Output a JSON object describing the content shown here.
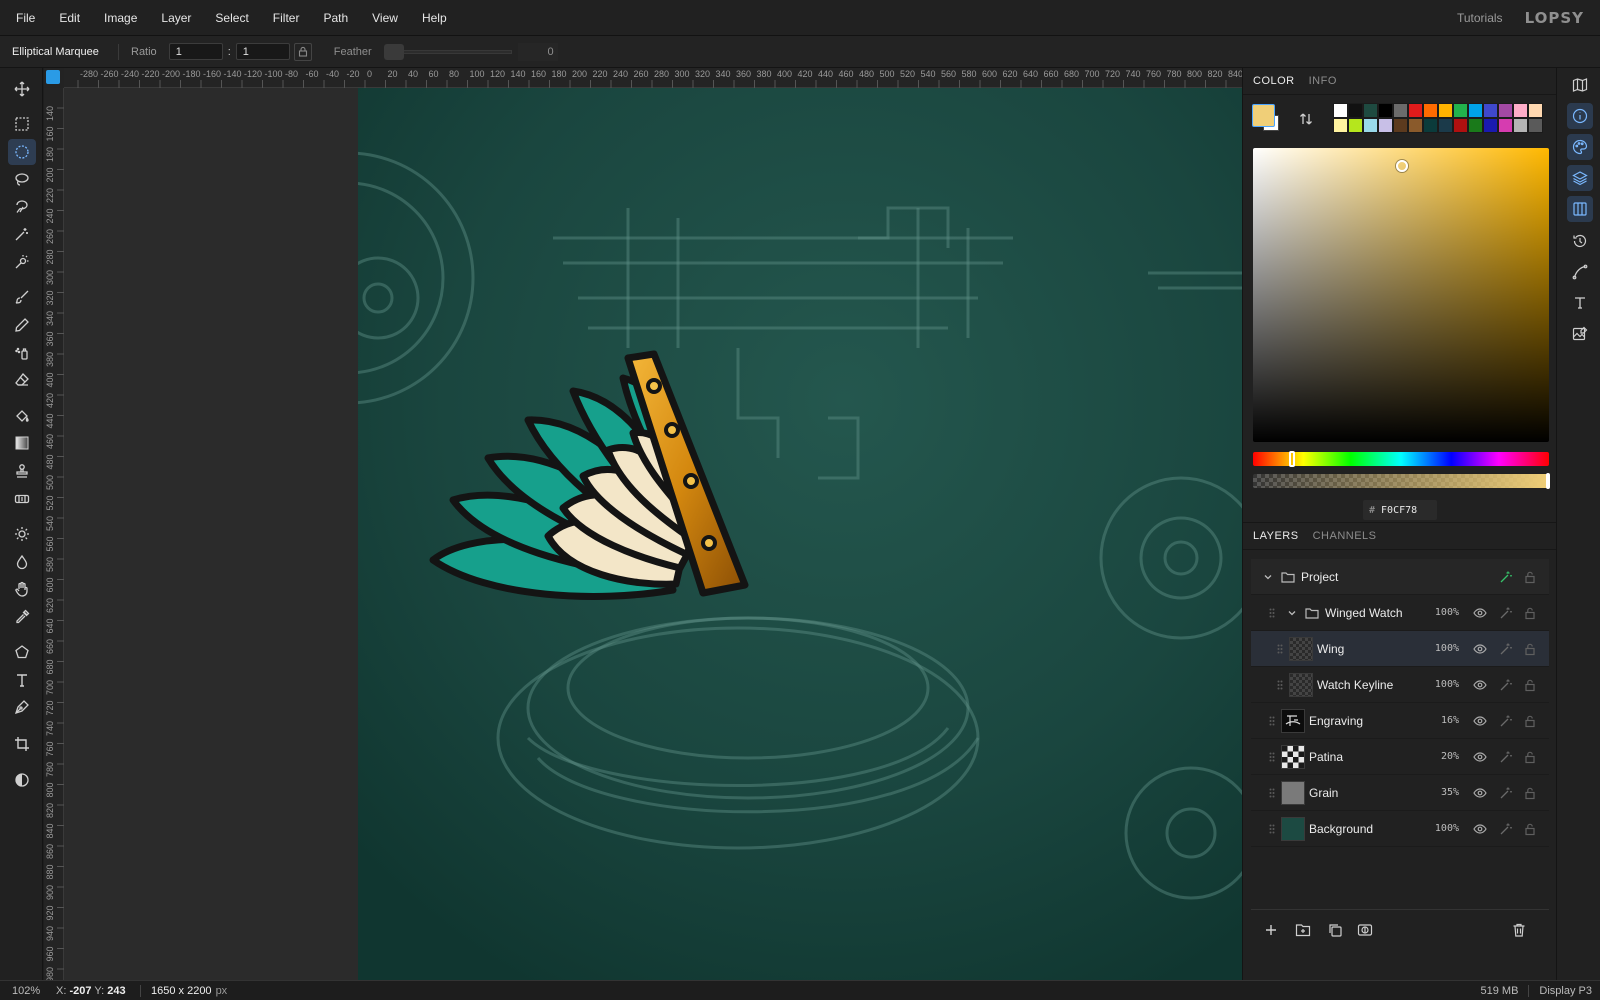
{
  "menu": [
    "File",
    "Edit",
    "Image",
    "Layer",
    "Select",
    "Filter",
    "Path",
    "View",
    "Help"
  ],
  "header": {
    "tutorials": "Tutorials",
    "brand": "LOPSY"
  },
  "options": {
    "tool_name": "Elliptical Marquee",
    "ratio_label": "Ratio",
    "ratio_w": "1",
    "ratio_colon": ":",
    "ratio_h": "1",
    "feather_label": "Feather",
    "feather_value": "0"
  },
  "tools": [
    {
      "name": "move-tool",
      "icon": "move-icon"
    },
    {
      "name": "rect-marquee-tool",
      "icon": "rect-marquee-icon"
    },
    {
      "name": "elliptical-marquee-tool",
      "icon": "ellipse-marquee-icon",
      "active": true
    },
    {
      "name": "lasso-tool",
      "icon": "lasso-icon"
    },
    {
      "name": "magnetic-lasso-tool",
      "icon": "magnetic-lasso-icon"
    },
    {
      "name": "magic-wand-tool",
      "icon": "magic-wand-icon"
    },
    {
      "name": "quick-selection-tool",
      "icon": "quick-selection-icon"
    },
    {
      "name": "brush-tool",
      "icon": "brush-icon"
    },
    {
      "name": "pencil-tool",
      "icon": "pencil-icon"
    },
    {
      "name": "spray-tool",
      "icon": "spray-icon"
    },
    {
      "name": "eraser-tool",
      "icon": "eraser-icon"
    },
    {
      "name": "paint-bucket-tool",
      "icon": "paint-bucket-icon"
    },
    {
      "name": "gradient-tool",
      "icon": "gradient-icon"
    },
    {
      "name": "clone-stamp-tool",
      "icon": "stamp-icon"
    },
    {
      "name": "healing-tool",
      "icon": "bandage-icon"
    },
    {
      "name": "dodge-tool",
      "icon": "sun-icon"
    },
    {
      "name": "blur-tool",
      "icon": "drop-icon"
    },
    {
      "name": "hand-tool",
      "icon": "hand-icon"
    },
    {
      "name": "eyedropper-tool",
      "icon": "eyedropper-icon"
    },
    {
      "name": "shape-tool",
      "icon": "pentagon-icon"
    },
    {
      "name": "text-tool",
      "icon": "text-icon"
    },
    {
      "name": "pen-tool",
      "icon": "pen-icon"
    },
    {
      "name": "crop-tool",
      "icon": "crop-icon"
    },
    {
      "name": "adjustment-tool",
      "icon": "contrast-icon"
    }
  ],
  "ruler_top_labels": [
    "-280",
    "-260",
    "-240",
    "-220",
    "-200",
    "-180",
    "-160",
    "-140",
    "-120",
    "-100",
    "-80",
    "-60",
    "-40",
    "-20",
    "0",
    "20",
    "40",
    "60",
    "80",
    "100",
    "120",
    "140",
    "160",
    "180",
    "200",
    "220",
    "240",
    "260",
    "280",
    "300",
    "320",
    "340",
    "360",
    "380",
    "400",
    "420",
    "440",
    "460",
    "480",
    "500",
    "520",
    "540",
    "560",
    "580",
    "600",
    "620",
    "640",
    "660",
    "680",
    "700",
    "720",
    "740",
    "760",
    "780",
    "800",
    "820",
    "840"
  ],
  "ruler_left_labels": [
    "140",
    "160",
    "180",
    "200",
    "220",
    "240",
    "260",
    "280",
    "300",
    "320",
    "340",
    "360",
    "380",
    "400",
    "420",
    "440",
    "460",
    "480",
    "500",
    "520",
    "540",
    "560",
    "580",
    "600",
    "620",
    "640",
    "660",
    "680",
    "700",
    "720",
    "740",
    "760",
    "780",
    "800",
    "820",
    "840",
    "860",
    "880",
    "900",
    "920",
    "940",
    "960",
    "980"
  ],
  "color_panel": {
    "tabs": [
      "COLOR",
      "INFO"
    ],
    "active_tab": "COLOR",
    "foreground": "#F0CF78",
    "background": "#FFFFFF",
    "hex_prefix": "#",
    "hex_value": "F0CF78",
    "swatches": [
      "#ffffff",
      "#111111",
      "#1e4a40",
      "#000000",
      "#6b6b6b",
      "#e01b1b",
      "#ff6a00",
      "#ffb300",
      "#22b14c",
      "#00a2e8",
      "#3f48cc",
      "#a349a4",
      "#ffaec9",
      "#ffd8b0",
      "#fff3a0",
      "#b5e61d",
      "#99d9ea",
      "#c8bfe7",
      "#5c3a1e",
      "#8a5a2b",
      "#0b3b3b",
      "#1b3a4a",
      "#b01010",
      "#1a7a1a",
      "#1a1ab0",
      "#d63cb0",
      "#b4b4b4",
      "#5a5a5a"
    ]
  },
  "layers_panel": {
    "tabs": [
      "LAYERS",
      "CHANNELS"
    ],
    "active_tab": "LAYERS",
    "layers": [
      {
        "name": "Project",
        "type": "group",
        "opacity": "",
        "depth": 0
      },
      {
        "name": "Winged Watch",
        "type": "group",
        "opacity": "100%",
        "depth": 1
      },
      {
        "name": "Wing",
        "type": "layer",
        "opacity": "100%",
        "depth": 2,
        "selected": true
      },
      {
        "name": "Watch Keyline",
        "type": "layer",
        "opacity": "100%",
        "depth": 2
      },
      {
        "name": "Engraving",
        "type": "layer",
        "opacity": "16%",
        "depth": 1
      },
      {
        "name": "Patina",
        "type": "layer",
        "opacity": "20%",
        "depth": 1
      },
      {
        "name": "Grain",
        "type": "layer",
        "opacity": "35%",
        "depth": 1
      },
      {
        "name": "Background",
        "type": "layer",
        "opacity": "100%",
        "depth": 1
      }
    ],
    "footer_icons": [
      "add-layer-icon",
      "add-group-icon",
      "duplicate-icon",
      "mask-icon",
      "trash-icon"
    ]
  },
  "icon_strip": [
    "map-icon",
    "info-icon",
    "palette-icon",
    "layers-icon",
    "channels-icon",
    "history-icon",
    "path-icon",
    "type-icon",
    "image-edit-icon"
  ],
  "status": {
    "zoom": "102%",
    "x_label": "X:",
    "x": "-207",
    "y_label": "Y:",
    "y": "243",
    "doc_size": "1650 x 2200",
    "doc_unit": "px",
    "memory": "519 MB",
    "color_profile": "Display P3"
  },
  "colors": {
    "accent": "#2a9be6",
    "canvas_bg": "#1c4a42",
    "wing_teal": "#16a08c",
    "wing_cream": "#f3e6c8",
    "strap_gold": "#d08a14"
  }
}
